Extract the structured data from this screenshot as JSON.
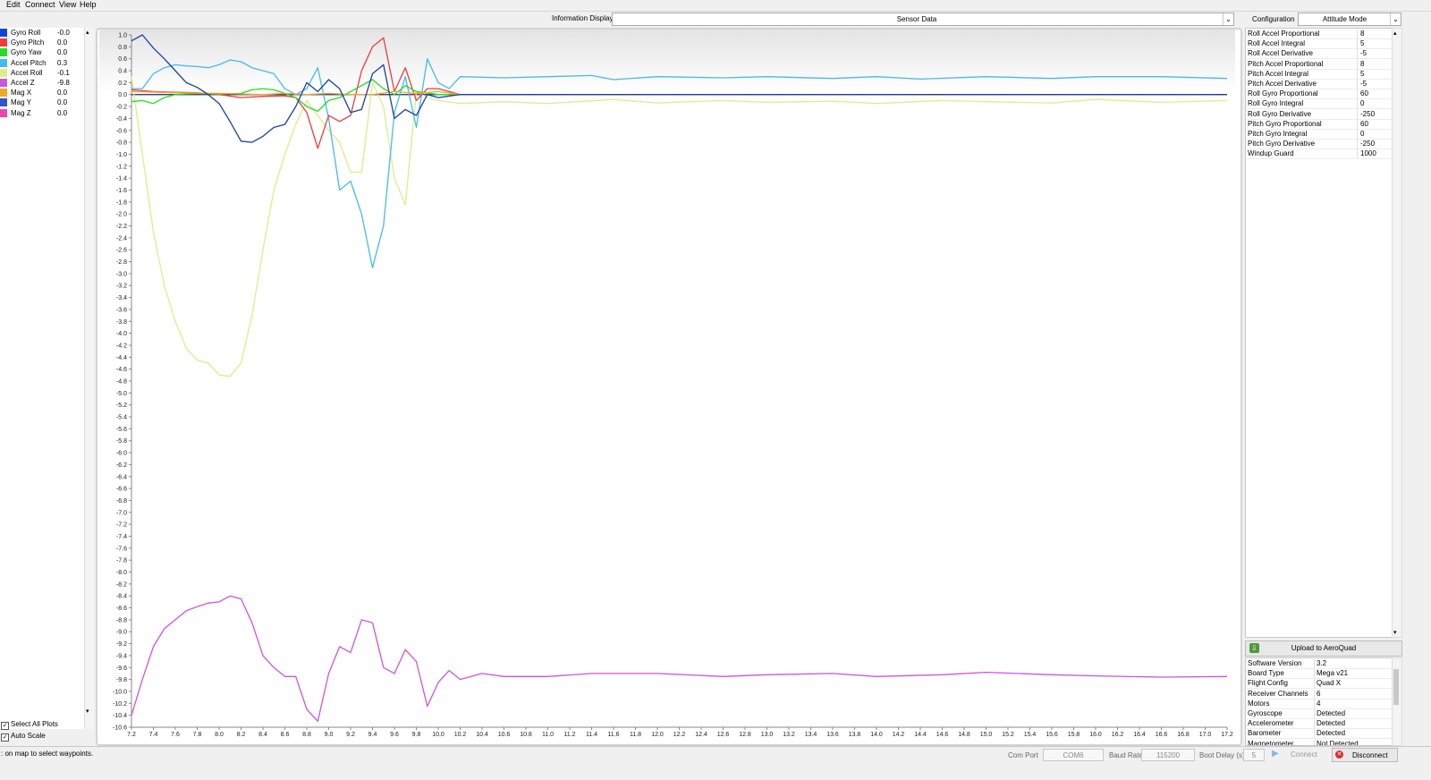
{
  "menu": [
    "Edit",
    "Connect",
    "View",
    "Help"
  ],
  "legend": [
    {
      "name": "Gyro Roll",
      "value": "-0.0",
      "color": "#1144dd"
    },
    {
      "name": "Gyro Pitch",
      "value": "0.0",
      "color": "#ee3b3b"
    },
    {
      "name": "Gyro Yaw",
      "value": "0.0",
      "color": "#22dd22"
    },
    {
      "name": "Accel Pitch",
      "value": "0.3",
      "color": "#44bbee"
    },
    {
      "name": "Accel Roll",
      "value": "-0.1",
      "color": "#ddee88"
    },
    {
      "name": "Accel Z",
      "value": "-9.8",
      "color": "#cc55dd"
    },
    {
      "name": "Mag X",
      "value": "0.0",
      "color": "#f5a623"
    },
    {
      "name": "Mag Y",
      "value": "0.0",
      "color": "#3355cc"
    },
    {
      "name": "Mag Z",
      "value": "0.0",
      "color": "#ee44aa"
    }
  ],
  "options": {
    "select_all": "Select All Plots",
    "auto_scale": "Auto Scale"
  },
  "info_display": {
    "label": "Information Display",
    "value": "Sensor Data"
  },
  "config": {
    "label": "Configuration",
    "mode": "Attitude Mode",
    "rows": [
      {
        "name": "Roll Accel Proportional",
        "value": "8"
      },
      {
        "name": "Roll Accel Integral",
        "value": "5"
      },
      {
        "name": "Roll Accel Derivative",
        "value": "-5"
      },
      {
        "name": "Pitch Accel Proportional",
        "value": "8"
      },
      {
        "name": "Pitch Accel Integral",
        "value": "5"
      },
      {
        "name": "Pitch Accel Derivative",
        "value": "-5"
      },
      {
        "name": "Roll Gyro Proportional",
        "value": "60"
      },
      {
        "name": "Roll Gyro Integral",
        "value": "0"
      },
      {
        "name": "Roll Gyro Derivative",
        "value": "-250"
      },
      {
        "name": "Pitch Gyro Proportional",
        "value": "60"
      },
      {
        "name": "Pitch Gyro Integral",
        "value": "0"
      },
      {
        "name": "Pitch Gyro Derivative",
        "value": "-250"
      },
      {
        "name": "Windup Guard",
        "value": "1000"
      }
    ]
  },
  "upload": {
    "label": "Upload to AeroQuad"
  },
  "info_rows": [
    {
      "name": "Software Version",
      "value": "3.2"
    },
    {
      "name": "Board Type",
      "value": "Mega v21"
    },
    {
      "name": "Flight Config",
      "value": "Quad X"
    },
    {
      "name": "Receiver Channels",
      "value": "6"
    },
    {
      "name": "Motors",
      "value": "4"
    },
    {
      "name": "Gyroscope",
      "value": "Detected"
    },
    {
      "name": "Accelerometer",
      "value": "Detected"
    },
    {
      "name": "Barometer",
      "value": "Detected"
    },
    {
      "name": "Magnetometer",
      "value": "Not Detected"
    }
  ],
  "status": {
    "message": ": on map to select waypoints.",
    "com_port_label": "Com Port",
    "com_port": "COM6",
    "baud_label": "Baud Rate",
    "baud": "115200",
    "boot_label": "Boot Delay (s)",
    "boot": "5",
    "connect": "Connect",
    "disconnect": "Disconnect"
  },
  "chart_data": {
    "type": "line",
    "xlim": [
      7.2,
      17.2
    ],
    "ylim": [
      -10.6,
      1.0
    ],
    "x_ticks": [
      "7.2",
      "7.4",
      "7.6",
      "7.8",
      "8.0",
      "8.2",
      "8.4",
      "8.6",
      "8.8",
      "9.0",
      "9.2",
      "9.4",
      "9.6",
      "9.8",
      "10.0",
      "10.2",
      "10.4",
      "10.6",
      "10.8",
      "11.0",
      "11.2",
      "11.4",
      "11.6",
      "11.8",
      "12.0",
      "12.2",
      "12.4",
      "12.6",
      "12.8",
      "13.0",
      "13.2",
      "13.4",
      "13.6",
      "13.8",
      "14.0",
      "14.2",
      "14.4",
      "14.6",
      "14.8",
      "15.0",
      "15.2",
      "15.4",
      "15.6",
      "15.8",
      "16.0",
      "16.2",
      "16.4",
      "16.6",
      "16.8",
      "17.0",
      "17.2"
    ],
    "y_ticks": [
      "1.0",
      "0.8",
      "0.6",
      "0.4",
      "0.2",
      "0.0",
      "-0.2",
      "-0.4",
      "-0.6",
      "-0.8",
      "-1.0",
      "-1.2",
      "-1.4",
      "-1.6",
      "-1.8",
      "-2.0",
      "-2.2",
      "-2.4",
      "-2.6",
      "-2.8",
      "-3.0",
      "-3.2",
      "-3.4",
      "-3.6",
      "-3.8",
      "-4.0",
      "-4.2",
      "-4.4",
      "-4.6",
      "-4.8",
      "-5.0",
      "-5.2",
      "-5.4",
      "-5.6",
      "-5.8",
      "-6.0",
      "-6.2",
      "-6.4",
      "-6.6",
      "-6.8",
      "-7.0",
      "-7.2",
      "-7.4",
      "-7.6",
      "-7.8",
      "-8.0",
      "-8.2",
      "-8.4",
      "-8.6",
      "-8.8",
      "-9.0",
      "-9.2",
      "-9.4",
      "-9.6",
      "-9.8",
      "-10.0",
      "-10.2",
      "-10.4",
      "-10.6"
    ],
    "series": [
      {
        "name": "Accel Roll",
        "color": "#ddee88",
        "points": [
          [
            7.2,
            0.3
          ],
          [
            7.3,
            -1.0
          ],
          [
            7.4,
            -2.3
          ],
          [
            7.5,
            -3.2
          ],
          [
            7.6,
            -3.8
          ],
          [
            7.7,
            -4.25
          ],
          [
            7.8,
            -4.45
          ],
          [
            7.9,
            -4.5
          ],
          [
            8.0,
            -4.7
          ],
          [
            8.1,
            -4.72
          ],
          [
            8.2,
            -4.5
          ],
          [
            8.3,
            -3.7
          ],
          [
            8.4,
            -2.6
          ],
          [
            8.5,
            -1.6
          ],
          [
            8.6,
            -1.0
          ],
          [
            8.7,
            -0.5
          ],
          [
            8.8,
            -0.1
          ],
          [
            8.9,
            -0.35
          ],
          [
            9.0,
            -0.6
          ],
          [
            9.1,
            -0.8
          ],
          [
            9.2,
            -1.3
          ],
          [
            9.3,
            -1.3
          ],
          [
            9.4,
            0.2
          ],
          [
            9.5,
            -0.2
          ],
          [
            9.6,
            -1.4
          ],
          [
            9.7,
            -1.85
          ],
          [
            9.8,
            0.05
          ],
          [
            9.9,
            -0.05
          ],
          [
            10.0,
            -0.1
          ],
          [
            10.2,
            -0.15
          ],
          [
            10.6,
            -0.12
          ],
          [
            11.0,
            -0.15
          ],
          [
            11.6,
            -0.08
          ],
          [
            12.0,
            -0.14
          ],
          [
            12.6,
            -0.1
          ],
          [
            13.0,
            -0.13
          ],
          [
            13.6,
            -0.11
          ],
          [
            14.0,
            -0.15
          ],
          [
            14.6,
            -0.1
          ],
          [
            15.0,
            -0.12
          ],
          [
            15.6,
            -0.14
          ],
          [
            16.0,
            -0.08
          ],
          [
            16.6,
            -0.13
          ],
          [
            17.2,
            -0.1
          ]
        ]
      },
      {
        "name": "Accel Z",
        "color": "#cc55dd",
        "points": [
          [
            7.2,
            -10.4
          ],
          [
            7.3,
            -9.8
          ],
          [
            7.4,
            -9.25
          ],
          [
            7.5,
            -8.95
          ],
          [
            7.6,
            -8.8
          ],
          [
            7.7,
            -8.65
          ],
          [
            7.8,
            -8.58
          ],
          [
            7.9,
            -8.52
          ],
          [
            8.0,
            -8.5
          ],
          [
            8.1,
            -8.4
          ],
          [
            8.2,
            -8.45
          ],
          [
            8.3,
            -8.85
          ],
          [
            8.4,
            -9.4
          ],
          [
            8.5,
            -9.6
          ],
          [
            8.6,
            -9.75
          ],
          [
            8.7,
            -9.75
          ],
          [
            8.8,
            -10.3
          ],
          [
            8.9,
            -10.5
          ],
          [
            9.0,
            -9.7
          ],
          [
            9.1,
            -9.25
          ],
          [
            9.2,
            -9.35
          ],
          [
            9.3,
            -8.8
          ],
          [
            9.4,
            -8.85
          ],
          [
            9.5,
            -9.6
          ],
          [
            9.6,
            -9.7
          ],
          [
            9.7,
            -9.3
          ],
          [
            9.8,
            -9.5
          ],
          [
            9.9,
            -10.25
          ],
          [
            10.0,
            -9.85
          ],
          [
            10.1,
            -9.65
          ],
          [
            10.2,
            -9.8
          ],
          [
            10.4,
            -9.7
          ],
          [
            10.6,
            -9.75
          ],
          [
            11.0,
            -9.75
          ],
          [
            11.4,
            -9.7
          ],
          [
            12.0,
            -9.7
          ],
          [
            12.6,
            -9.75
          ],
          [
            13.0,
            -9.72
          ],
          [
            13.6,
            -9.7
          ],
          [
            14.0,
            -9.75
          ],
          [
            14.6,
            -9.72
          ],
          [
            15.0,
            -9.68
          ],
          [
            15.6,
            -9.72
          ],
          [
            16.0,
            -9.74
          ],
          [
            16.6,
            -9.76
          ],
          [
            17.2,
            -9.75
          ]
        ]
      },
      {
        "name": "Accel Pitch",
        "color": "#44bbee",
        "points": [
          [
            7.2,
            0.1
          ],
          [
            7.3,
            0.1
          ],
          [
            7.4,
            0.35
          ],
          [
            7.5,
            0.45
          ],
          [
            7.6,
            0.5
          ],
          [
            7.7,
            0.48
          ],
          [
            7.8,
            0.47
          ],
          [
            7.9,
            0.45
          ],
          [
            8.0,
            0.5
          ],
          [
            8.1,
            0.58
          ],
          [
            8.2,
            0.55
          ],
          [
            8.3,
            0.45
          ],
          [
            8.4,
            0.4
          ],
          [
            8.5,
            0.35
          ],
          [
            8.6,
            0.1
          ],
          [
            8.7,
            0.0
          ],
          [
            8.8,
            0.1
          ],
          [
            8.9,
            0.45
          ],
          [
            9.0,
            -0.4
          ],
          [
            9.1,
            -1.6
          ],
          [
            9.2,
            -1.45
          ],
          [
            9.3,
            -2.0
          ],
          [
            9.4,
            -2.9
          ],
          [
            9.5,
            -2.2
          ],
          [
            9.6,
            -0.3
          ],
          [
            9.7,
            0.3
          ],
          [
            9.8,
            -0.55
          ],
          [
            9.9,
            0.6
          ],
          [
            10.0,
            0.2
          ],
          [
            10.1,
            0.1
          ],
          [
            10.2,
            0.3
          ],
          [
            10.6,
            0.28
          ],
          [
            11.0,
            0.3
          ],
          [
            11.4,
            0.32
          ],
          [
            11.6,
            0.25
          ],
          [
            12.0,
            0.3
          ],
          [
            12.6,
            0.28
          ],
          [
            13.0,
            0.3
          ],
          [
            13.6,
            0.27
          ],
          [
            14.0,
            0.3
          ],
          [
            14.4,
            0.26
          ],
          [
            15.0,
            0.3
          ],
          [
            15.6,
            0.27
          ],
          [
            16.0,
            0.3
          ],
          [
            16.6,
            0.3
          ],
          [
            17.2,
            0.27
          ]
        ]
      },
      {
        "name": "Gyro Pitch",
        "color": "#ee3b3b",
        "points": [
          [
            7.2,
            0.08
          ],
          [
            7.4,
            0.05
          ],
          [
            7.6,
            0.04
          ],
          [
            7.8,
            0.03
          ],
          [
            8.0,
            0.0
          ],
          [
            8.2,
            -0.05
          ],
          [
            8.4,
            -0.03
          ],
          [
            8.6,
            -0.02
          ],
          [
            8.7,
            -0.05
          ],
          [
            8.8,
            -0.3
          ],
          [
            8.9,
            -0.9
          ],
          [
            9.0,
            -0.35
          ],
          [
            9.1,
            -0.45
          ],
          [
            9.2,
            -0.35
          ],
          [
            9.3,
            0.4
          ],
          [
            9.4,
            0.8
          ],
          [
            9.5,
            0.95
          ],
          [
            9.6,
            0.05
          ],
          [
            9.7,
            0.45
          ],
          [
            9.8,
            -0.1
          ],
          [
            9.9,
            0.1
          ],
          [
            10.0,
            0.1
          ],
          [
            10.2,
            0.0
          ],
          [
            17.2,
            0.0
          ]
        ]
      },
      {
        "name": "Gyro Yaw",
        "color": "#22dd22",
        "points": [
          [
            7.2,
            -0.12
          ],
          [
            7.3,
            -0.1
          ],
          [
            7.4,
            -0.15
          ],
          [
            7.5,
            -0.05
          ],
          [
            7.6,
            0.0
          ],
          [
            7.8,
            0.02
          ],
          [
            8.0,
            0.01
          ],
          [
            8.2,
            0.02
          ],
          [
            8.3,
            0.08
          ],
          [
            8.4,
            0.1
          ],
          [
            8.5,
            0.08
          ],
          [
            8.6,
            0.02
          ],
          [
            8.7,
            -0.05
          ],
          [
            8.8,
            -0.2
          ],
          [
            8.9,
            -0.28
          ],
          [
            9.0,
            -0.1
          ],
          [
            9.1,
            -0.05
          ],
          [
            9.2,
            0.05
          ],
          [
            9.3,
            0.15
          ],
          [
            9.4,
            0.25
          ],
          [
            9.5,
            0.1
          ],
          [
            9.6,
            0.0
          ],
          [
            9.7,
            0.15
          ],
          [
            9.8,
            0.05
          ],
          [
            10.0,
            0.0
          ],
          [
            17.2,
            0.0
          ]
        ]
      },
      {
        "name": "Mag X",
        "color": "#f5a623",
        "points": [
          [
            7.2,
            0.05
          ],
          [
            7.6,
            0.03
          ],
          [
            8.0,
            0.02
          ],
          [
            8.4,
            0.0
          ],
          [
            8.6,
            0.02
          ],
          [
            8.8,
            0.0
          ],
          [
            9.0,
            0.02
          ],
          [
            9.2,
            0.0
          ],
          [
            9.4,
            0.0
          ],
          [
            9.6,
            0.05
          ],
          [
            9.8,
            0.02
          ],
          [
            10.0,
            0.05
          ],
          [
            10.2,
            0.0
          ],
          [
            17.2,
            0.0
          ]
        ]
      },
      {
        "name": "Gyro Roll",
        "color": "#1b3fa8",
        "points": [
          [
            7.2,
            0.9
          ],
          [
            7.3,
            1.0
          ],
          [
            7.4,
            0.78
          ],
          [
            7.5,
            0.6
          ],
          [
            7.6,
            0.4
          ],
          [
            7.7,
            0.2
          ],
          [
            7.8,
            0.12
          ],
          [
            7.9,
            0.0
          ],
          [
            8.0,
            -0.15
          ],
          [
            8.1,
            -0.45
          ],
          [
            8.2,
            -0.78
          ],
          [
            8.3,
            -0.8
          ],
          [
            8.4,
            -0.7
          ],
          [
            8.5,
            -0.55
          ],
          [
            8.6,
            -0.5
          ],
          [
            8.7,
            -0.2
          ],
          [
            8.8,
            0.2
          ],
          [
            8.9,
            0.05
          ],
          [
            9.0,
            0.25
          ],
          [
            9.1,
            0.1
          ],
          [
            9.2,
            -0.3
          ],
          [
            9.3,
            -0.25
          ],
          [
            9.4,
            0.35
          ],
          [
            9.5,
            0.5
          ],
          [
            9.6,
            -0.4
          ],
          [
            9.7,
            -0.25
          ],
          [
            9.8,
            -0.35
          ],
          [
            9.9,
            0.0
          ],
          [
            10.0,
            -0.05
          ],
          [
            10.2,
            0.0
          ],
          [
            17.2,
            0.0
          ]
        ]
      }
    ]
  }
}
